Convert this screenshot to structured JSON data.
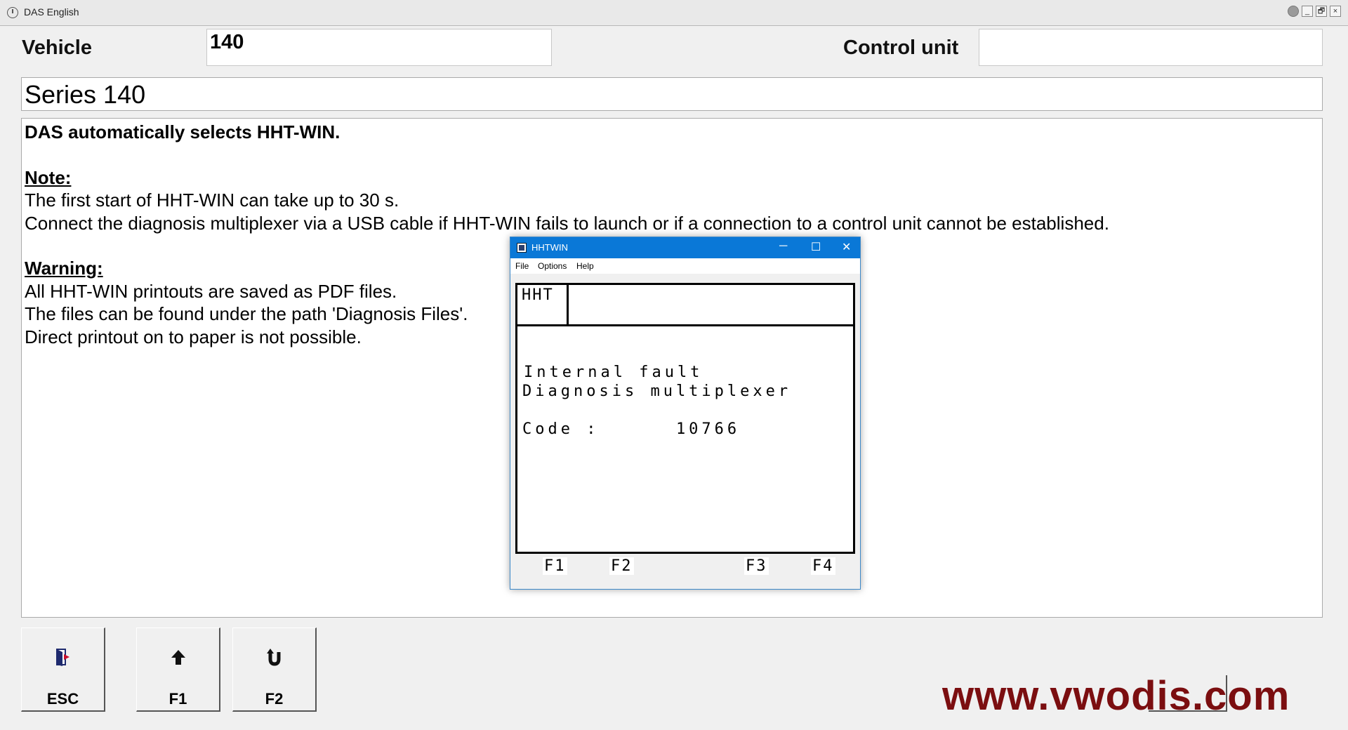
{
  "window": {
    "title": "DAS English",
    "controls": [
      "_",
      "🗗",
      "×"
    ]
  },
  "header": {
    "vehicle_label": "Vehicle",
    "vehicle_value": "140",
    "control_unit_label": "Control unit",
    "control_unit_value": ""
  },
  "series": "Series 140",
  "content": {
    "heading": "DAS automatically selects HHT-WIN.",
    "note_title": "Note:",
    "note_lines": [
      "The first start of HHT-WIN can take up to 30 s.",
      "Connect the diagnosis multiplexer via a USB cable if HHT-WIN fails to launch or if a connection to a control unit cannot be established."
    ],
    "warning_title": "Warning:",
    "warning_lines": [
      "All HHT-WIN printouts are saved as PDF files.",
      "The files can be found under the path 'Diagnosis Files'.",
      "Direct printout on to paper is not possible."
    ]
  },
  "buttons": [
    {
      "label": "ESC",
      "icon": "exit-door-icon"
    },
    {
      "label": "F1",
      "icon": "arrow-up-icon"
    },
    {
      "label": "F2",
      "icon": "return-arrow-icon"
    }
  ],
  "hhtwin": {
    "title": "HHTWIN",
    "menu": [
      "File",
      "Options",
      "Help"
    ],
    "header_cell": "HHT",
    "lines": [
      "Internal fault",
      "Diagnosis multiplexer",
      "Code :      10766"
    ],
    "fkeys": [
      "F1",
      "F2",
      "F3",
      "F4"
    ]
  },
  "watermark": "www.vwodis.com"
}
